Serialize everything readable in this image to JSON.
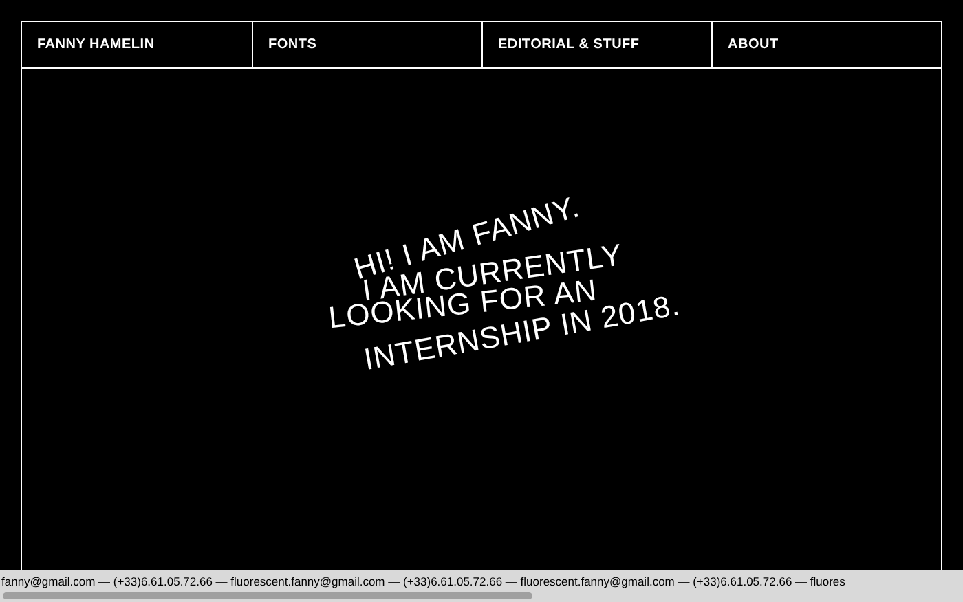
{
  "nav": [
    {
      "label": "FANNY HAMELIN"
    },
    {
      "label": "FONTS"
    },
    {
      "label": "EDITORIAL & STUFF"
    },
    {
      "label": "ABOUT"
    }
  ],
  "headline": [
    "HI! I AM FANNY.",
    "I AM CURRENTLY",
    "LOOKING FOR AN",
    "INTERNSHIP IN 2018."
  ],
  "ticker": "fanny@gmail.com — (+33)6.61.05.72.66 — fluorescent.fanny@gmail.com — (+33)6.61.05.72.66 — fluorescent.fanny@gmail.com — (+33)6.61.05.72.66 — fluores"
}
